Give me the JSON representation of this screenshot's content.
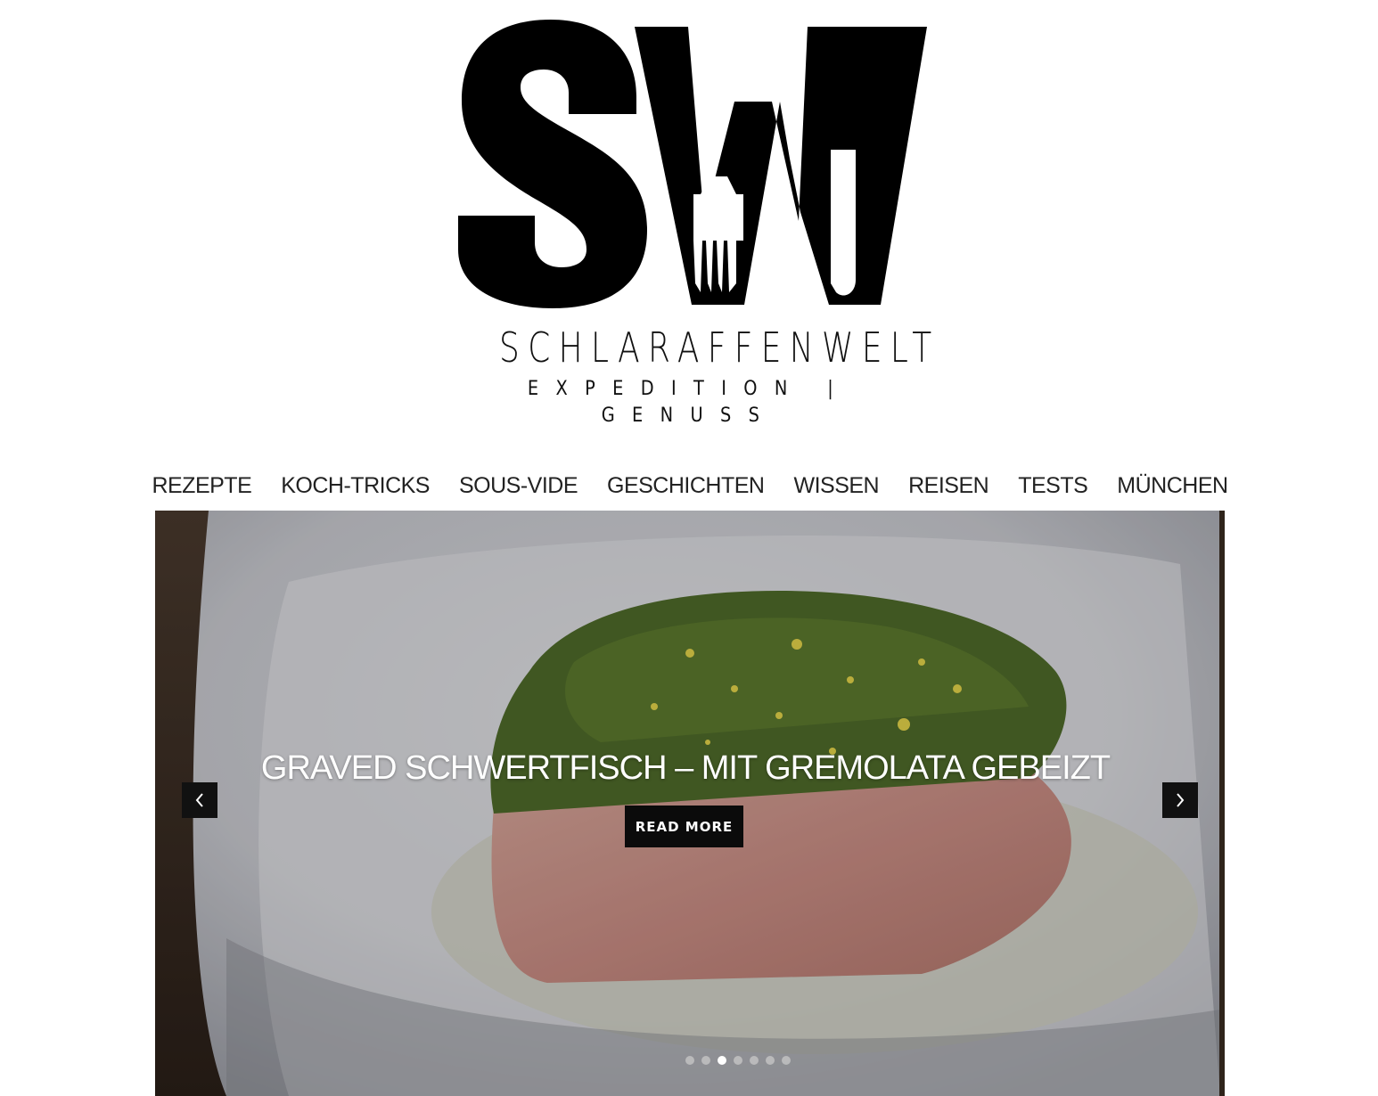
{
  "brand": {
    "monogram": "SW",
    "name": "SCHLARAFFENWELT",
    "tagline": "EXPEDITION | GENUSS"
  },
  "nav": {
    "items": [
      {
        "label": "REZEPTE"
      },
      {
        "label": "KOCH-TRICKS"
      },
      {
        "label": "SOUS-VIDE"
      },
      {
        "label": "GESCHICHTEN"
      },
      {
        "label": "WISSEN"
      },
      {
        "label": "REISEN"
      },
      {
        "label": "TESTS"
      },
      {
        "label": "MÜNCHEN"
      }
    ]
  },
  "slider": {
    "title": "GRAVED SCHWERTFISCH – MIT GREMOLATA GEBEIZT",
    "button_label": "READ MORE",
    "prev_icon": "chevron-left-icon",
    "next_icon": "chevron-right-icon",
    "slide_count": 7,
    "active_slide": 3
  },
  "colors": {
    "text": "#222222",
    "button_bg": "#0b0b0b",
    "button_text": "#ffffff"
  }
}
